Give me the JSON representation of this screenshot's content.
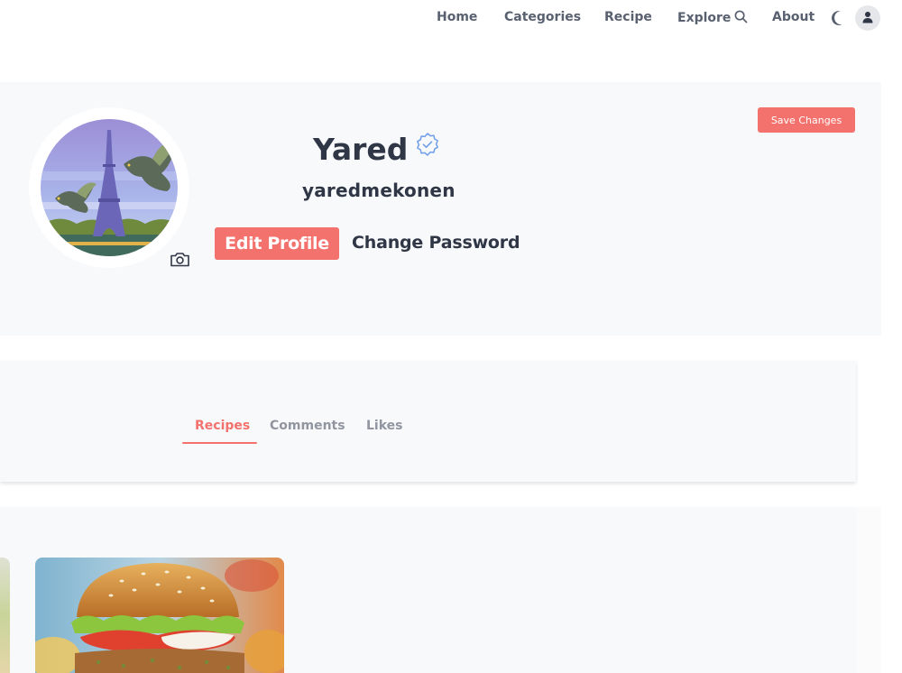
{
  "nav": {
    "items": [
      {
        "label": "Home"
      },
      {
        "label": "Categories"
      },
      {
        "label": "Recipe"
      },
      {
        "label": "Explore"
      },
      {
        "label": "About"
      }
    ],
    "explore_icon": "search-icon",
    "theme_icon": "moon-icon",
    "account_icon": "user-icon"
  },
  "profile": {
    "display_name": "Yared",
    "username": "yaredmekonen",
    "verified_icon": "verified-badge-icon",
    "edit_profile_label": "Edit Profile",
    "change_password_label": "Change Password",
    "save_label": "Save Changes",
    "camera_icon": "camera-icon"
  },
  "tabs": [
    {
      "label": "Recipes",
      "active": true
    },
    {
      "label": "Comments",
      "active": false
    },
    {
      "label": "Likes",
      "active": false
    }
  ],
  "colors": {
    "accent": "#f4726d",
    "text": "#2f3645",
    "muted": "#9095a0",
    "panel": "#f8f9fb",
    "verified": "#6f9ee8"
  }
}
